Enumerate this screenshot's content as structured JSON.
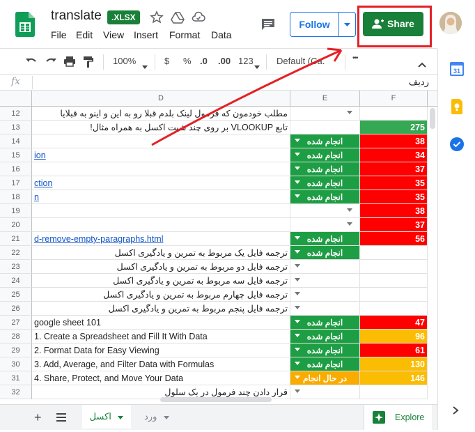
{
  "header": {
    "title": "translate",
    "badge": ".XLSX",
    "menu": [
      "File",
      "Edit",
      "View",
      "Insert",
      "Format",
      "Data"
    ],
    "follow_label": "Follow",
    "share_label": "Share"
  },
  "toolbar": {
    "zoom": "100%",
    "currency": "$",
    "percent": "%",
    "dec_decrease": ".0",
    "dec_increase": ".00",
    "number_format": "123",
    "font": "Default (Ca...",
    "more": "•••"
  },
  "formula_bar": {
    "fx": "fx",
    "value": "ردیف"
  },
  "columns": [
    "D",
    "E",
    "F"
  ],
  "rows": [
    {
      "num": "12",
      "d": "مطلب خودمون که فرمول لینک بلدم قبلا رو به این و اینو به قبلایا",
      "d_type": "rtl",
      "e": "",
      "e_style": "arrow-grey",
      "f": "",
      "f_color": ""
    },
    {
      "num": "13",
      "d": "تابع VLOOKUP بر روی چند شیت اکسل به همراه مثال!",
      "d_type": "rtl",
      "e": "",
      "e_style": "",
      "f": "275",
      "f_color": "#34a853"
    },
    {
      "num": "14",
      "d": "",
      "d_type": "",
      "e": "انجام شده",
      "e_style": "green",
      "f": "38",
      "f_color": "#ff0000"
    },
    {
      "num": "15",
      "d": "ion",
      "d_type": "link",
      "e": "انجام شده",
      "e_style": "green",
      "f": "34",
      "f_color": "#ff0000"
    },
    {
      "num": "16",
      "d": "",
      "d_type": "",
      "e": "انجام شده",
      "e_style": "green",
      "f": "37",
      "f_color": "#ff0000"
    },
    {
      "num": "17",
      "d": "ction",
      "d_type": "link",
      "e": "انجام شده",
      "e_style": "green",
      "f": "35",
      "f_color": "#ff0000"
    },
    {
      "num": "18",
      "d": "n",
      "d_type": "link",
      "e": "انجام شده",
      "e_style": "green",
      "f": "35",
      "f_color": "#ff0000"
    },
    {
      "num": "19",
      "d": "",
      "d_type": "",
      "e": "",
      "e_style": "arrow-grey",
      "f": "38",
      "f_color": "#ff0000"
    },
    {
      "num": "20",
      "d": "",
      "d_type": "",
      "e": "",
      "e_style": "arrow-grey",
      "f": "37",
      "f_color": "#ff0000"
    },
    {
      "num": "21",
      "d": "d-remove-empty-paragraphs.html",
      "d_type": "link",
      "e": "انجام شده",
      "e_style": "green",
      "f": "56",
      "f_color": "#ff0000"
    },
    {
      "num": "22",
      "d": "ترجمه فایل یک مربوط به تمرین و یادگیری اکسل",
      "d_type": "rtl",
      "e": "انجام شده",
      "e_style": "green",
      "f": "",
      "f_color": ""
    },
    {
      "num": "23",
      "d": "ترجمه فایل دو مربوط به تمرین و یادگیری اکسل",
      "d_type": "rtl",
      "e": "",
      "e_style": "arrow-grey-left",
      "f": "",
      "f_color": ""
    },
    {
      "num": "24",
      "d": "ترجمه فایل سه مربوط به تمرین و یادگیری اکسل",
      "d_type": "rtl",
      "e": "",
      "e_style": "arrow-grey-left",
      "f": "",
      "f_color": ""
    },
    {
      "num": "25",
      "d": "ترجمه فایل چهارم مربوط به تمرین و یادگیری اکسل",
      "d_type": "rtl",
      "e": "",
      "e_style": "arrow-grey-left",
      "f": "",
      "f_color": ""
    },
    {
      "num": "26",
      "d": "ترجمه فایل پنجم مربوط به تمرین و یادگیری اکسل",
      "d_type": "rtl",
      "e": "",
      "e_style": "arrow-grey-left",
      "f": "",
      "f_color": ""
    },
    {
      "num": "27",
      "d": "google sheet 101",
      "d_type": "ltr",
      "e": "انجام شده",
      "e_style": "green",
      "f": "47",
      "f_color": "#ff0000"
    },
    {
      "num": "28",
      "d": "1. Create a Spreadsheet and Fill It With Data",
      "d_type": "ltr",
      "e": "انجام شده",
      "e_style": "green",
      "f": "96",
      "f_color": "#fbbc04"
    },
    {
      "num": "29",
      "d": "2. Format Data for Easy Viewing",
      "d_type": "ltr",
      "e": "انجام شده",
      "e_style": "green",
      "f": "61",
      "f_color": "#ff0000"
    },
    {
      "num": "30",
      "d": "3. Add, Average, and Filter Data with Formulas",
      "d_type": "ltr",
      "e": "انجام شده",
      "e_style": "green",
      "f": "130",
      "f_color": "#fbbc04"
    },
    {
      "num": "31",
      "d": "4. Share, Protect, and Move Your Data",
      "d_type": "ltr",
      "e": "در حال انجام",
      "e_style": "yellow",
      "f": "146",
      "f_color": "#fbbc04"
    },
    {
      "num": "32",
      "d": "قرار دادن چند فرمول در یک سلول",
      "d_type": "rtl",
      "e": "",
      "e_style": "arrow-grey-left",
      "f": "",
      "f_color": ""
    }
  ],
  "sheets": {
    "active": "اکسل",
    "other": "ورد"
  },
  "explore_label": "Explore",
  "colors": {
    "green": "#188038",
    "status_green": "#1e9e44",
    "status_yellow": "#f9ab00",
    "red_alert": "#e32126"
  }
}
